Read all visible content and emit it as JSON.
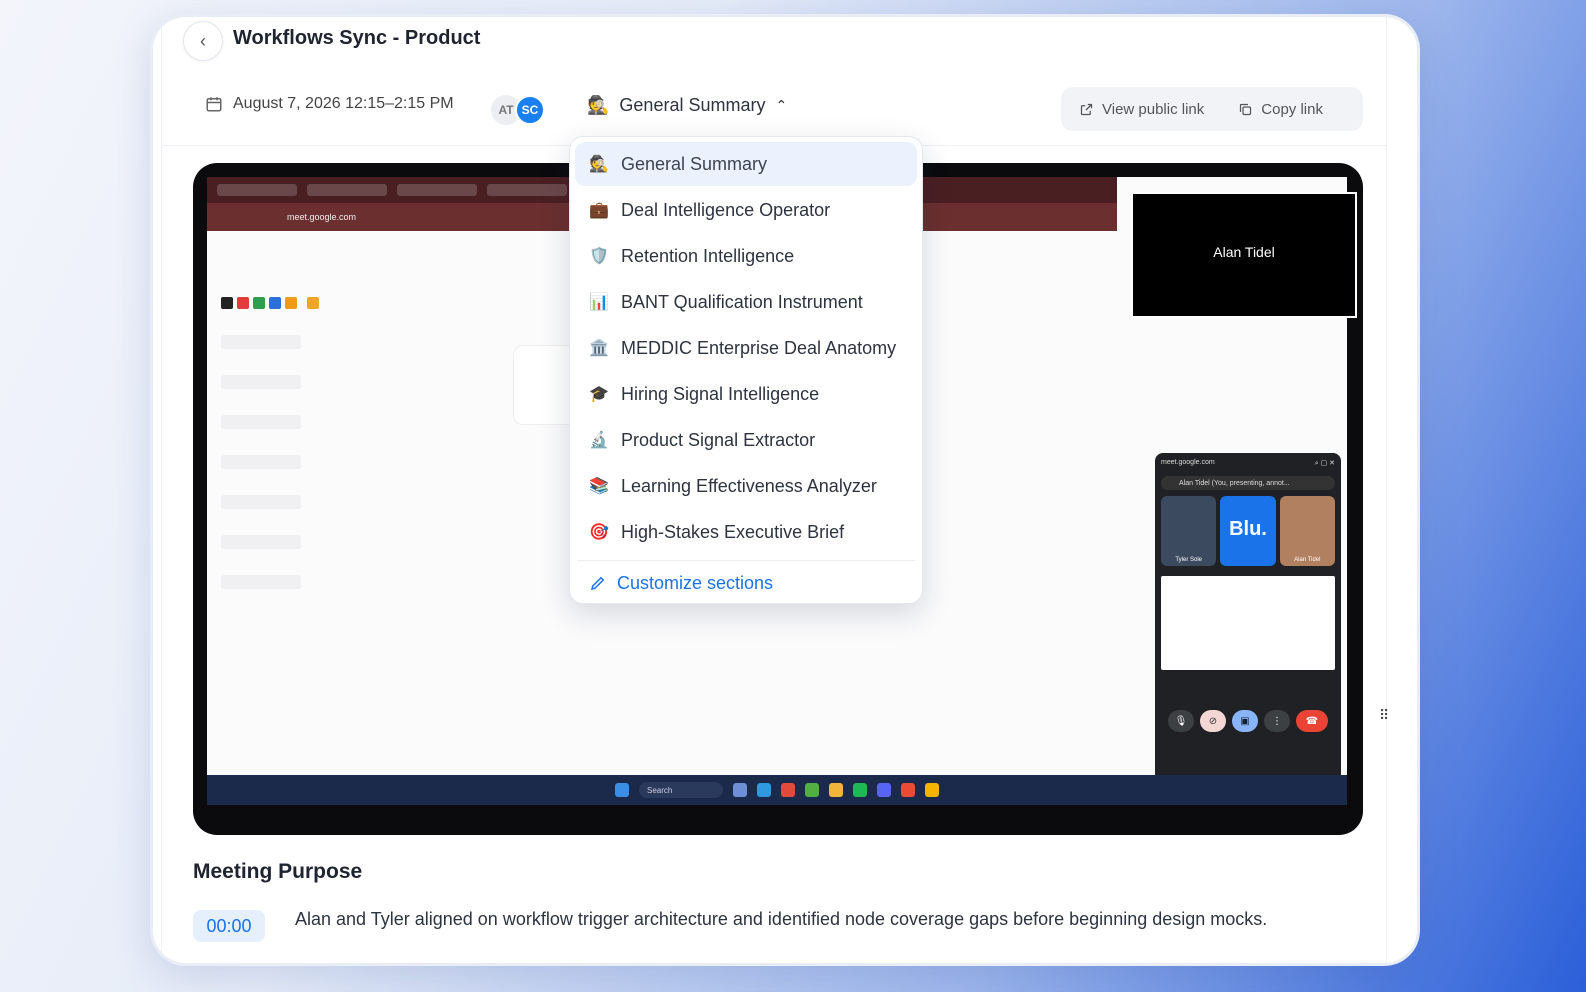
{
  "header": {
    "title": "Workflows Sync - Product",
    "back_icon": "chevron-left-icon"
  },
  "meeting": {
    "date_range": "August 7, 2026 12:15–2:15 PM",
    "avatars": [
      {
        "initials": "AT",
        "color": "#eceef2"
      },
      {
        "initials": "SC",
        "color": "#1a7ff0"
      }
    ]
  },
  "summary_selector": {
    "selected": "General Summary",
    "emoji": "🕵️"
  },
  "links": {
    "view_public": "View public link",
    "copy": "Copy link"
  },
  "dropdown": {
    "items": [
      {
        "label": "General Summary",
        "emoji": "🕵️",
        "active": true
      },
      {
        "label": "Deal Intelligence Operator",
        "emoji": "💼"
      },
      {
        "label": "Retention Intelligence",
        "emoji": "🛡️"
      },
      {
        "label": "BANT Qualification Instrument",
        "emoji": "📊"
      },
      {
        "label": "MEDDIC Enterprise Deal Anatomy",
        "emoji": "🏛️"
      },
      {
        "label": "Hiring Signal Intelligence",
        "emoji": "🎓"
      },
      {
        "label": "Product Signal Extractor",
        "emoji": "🔬"
      },
      {
        "label": "Learning Effectiveness Analyzer",
        "emoji": "📚"
      },
      {
        "label": "High-Stakes Executive Brief",
        "emoji": "🎯"
      }
    ],
    "customize": "Customize sections"
  },
  "video": {
    "speaker": "Alan Tidel",
    "address": "meet.google.com",
    "meet_user": "Alan Tidel (You, presenting, annot...",
    "tiles": [
      "Tyler Sole",
      "Blu.",
      "Alan Tidel"
    ],
    "taskbar_search": "Search"
  },
  "section": {
    "title": "Meeting Purpose",
    "timestamp": "00:00",
    "text": "Alan and Tyler aligned on workflow trigger architecture and identified node coverage gaps before beginning design mocks."
  }
}
